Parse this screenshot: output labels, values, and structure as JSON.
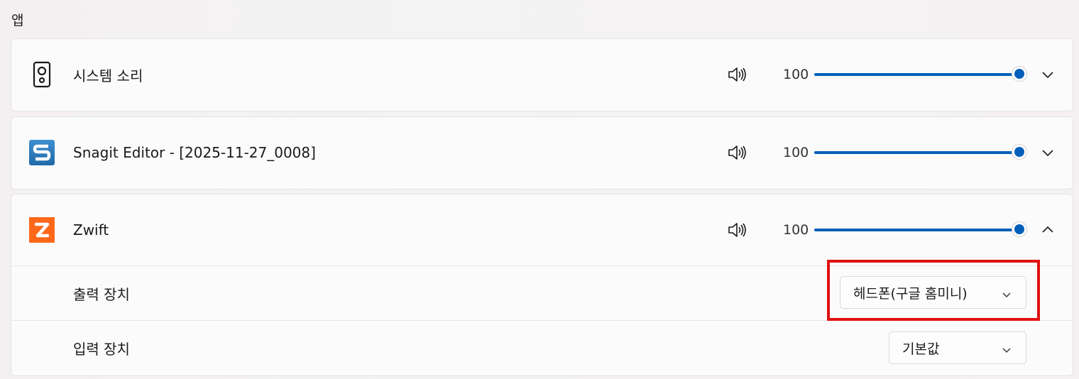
{
  "section": {
    "title": "앱"
  },
  "apps": [
    {
      "name": "시스템 소리",
      "icon": "system-sounds-speaker-icon",
      "volume": "100",
      "volume_level": 100,
      "expanded": false
    },
    {
      "name": "Snagit Editor - [2025-11-27_0008]",
      "icon": "snagit-logo-icon",
      "volume": "100",
      "volume_level": 100,
      "expanded": false
    },
    {
      "name": "Zwift",
      "icon": "zwift-logo-icon",
      "volume": "100",
      "volume_level": 100,
      "expanded": true
    }
  ],
  "zwift_details": {
    "output_label": "출력 장치",
    "output_value": "헤드폰(구글 홈미니)",
    "input_label": "입력 장치",
    "input_value": "기본값"
  },
  "colors": {
    "accent": "#005fb8",
    "highlight": "#e01010",
    "snagit": "#2f7fc1",
    "zwift": "#fc6719"
  }
}
